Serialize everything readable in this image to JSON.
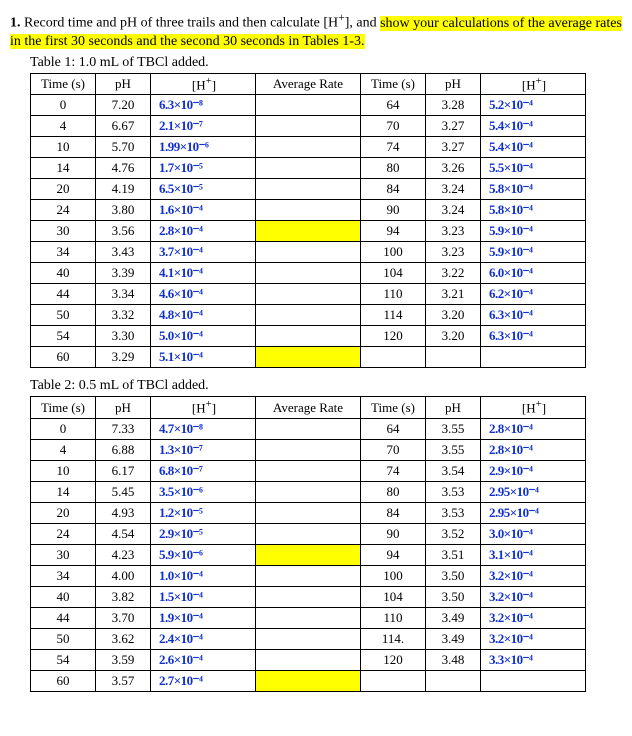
{
  "prompt": {
    "num": "1.",
    "plain1": " Record time and pH of three trails and then calculate [H",
    "sup1": "+",
    "plain2": "], and ",
    "hl": "show your calculations of the average rates in the first 30 seconds and the second 30 seconds in Tables 1-3."
  },
  "headers": {
    "time": "Time (s)",
    "ph": "pH",
    "h_pre": "[H",
    "h_sup": "+",
    "h_post": "]",
    "rate": "Average Rate"
  },
  "table1": {
    "caption": "Table 1: 1.0 mL of TBCl added.",
    "left": [
      {
        "t": "0",
        "ph": "7.20",
        "h": "6.3×10⁻⁸",
        "hl": false
      },
      {
        "t": "4",
        "ph": "6.67",
        "h": "2.1×10⁻⁷",
        "hl": false
      },
      {
        "t": "10",
        "ph": "5.70",
        "h": "1.99×10⁻⁶",
        "hl": false
      },
      {
        "t": "14",
        "ph": "4.76",
        "h": "1.7×10⁻⁵",
        "hl": false
      },
      {
        "t": "20",
        "ph": "4.19",
        "h": "6.5×10⁻⁵",
        "hl": false
      },
      {
        "t": "24",
        "ph": "3.80",
        "h": "1.6×10⁻⁴",
        "hl": false
      },
      {
        "t": "30",
        "ph": "3.56",
        "h": "2.8×10⁻⁴",
        "hl": true
      },
      {
        "t": "34",
        "ph": "3.43",
        "h": "3.7×10⁻⁴",
        "hl": false
      },
      {
        "t": "40",
        "ph": "3.39",
        "h": "4.1×10⁻⁴",
        "hl": false
      },
      {
        "t": "44",
        "ph": "3.34",
        "h": "4.6×10⁻⁴",
        "hl": false
      },
      {
        "t": "50",
        "ph": "3.32",
        "h": "4.8×10⁻⁴",
        "hl": false
      },
      {
        "t": "54",
        "ph": "3.30",
        "h": "5.0×10⁻⁴",
        "hl": false
      },
      {
        "t": "60",
        "ph": "3.29",
        "h": "5.1×10⁻⁴",
        "hl": true
      }
    ],
    "right": [
      {
        "t": "64",
        "ph": "3.28",
        "h": "5.2×10⁻⁴"
      },
      {
        "t": "70",
        "ph": "3.27",
        "h": "5.4×10⁻⁴"
      },
      {
        "t": "74",
        "ph": "3.27",
        "h": "5.4×10⁻⁴"
      },
      {
        "t": "80",
        "ph": "3.26",
        "h": "5.5×10⁻⁴"
      },
      {
        "t": "84",
        "ph": "3.24",
        "h": "5.8×10⁻⁴"
      },
      {
        "t": "90",
        "ph": "3.24",
        "h": "5.8×10⁻⁴"
      },
      {
        "t": "94",
        "ph": "3.23",
        "h": "5.9×10⁻⁴"
      },
      {
        "t": "100",
        "ph": "3.23",
        "h": "5.9×10⁻⁴"
      },
      {
        "t": "104",
        "ph": "3.22",
        "h": "6.0×10⁻⁴"
      },
      {
        "t": "110",
        "ph": "3.21",
        "h": "6.2×10⁻⁴"
      },
      {
        "t": "114",
        "ph": "3.20",
        "h": "6.3×10⁻⁴"
      },
      {
        "t": "120",
        "ph": "3.20",
        "h": "6.3×10⁻⁴"
      }
    ]
  },
  "table2": {
    "caption": "Table 2: 0.5 mL of TBCl added.",
    "left": [
      {
        "t": "0",
        "ph": "7.33",
        "h": "4.7×10⁻⁸",
        "hl": false
      },
      {
        "t": "4",
        "ph": "6.88",
        "h": "1.3×10⁻⁷",
        "hl": false
      },
      {
        "t": "10",
        "ph": "6.17",
        "h": "6.8×10⁻⁷",
        "hl": false
      },
      {
        "t": "14",
        "ph": "5.45",
        "h": "3.5×10⁻⁶",
        "hl": false
      },
      {
        "t": "20",
        "ph": "4.93",
        "h": "1.2×10⁻⁵",
        "hl": false
      },
      {
        "t": "24",
        "ph": "4.54",
        "h": "2.9×10⁻⁵",
        "hl": false
      },
      {
        "t": "30",
        "ph": "4.23",
        "h": "5.9×10⁻⁶",
        "hl": true
      },
      {
        "t": "34",
        "ph": "4.00",
        "h": "1.0×10⁻⁴",
        "hl": false
      },
      {
        "t": "40",
        "ph": "3.82",
        "h": "1.5×10⁻⁴",
        "hl": false
      },
      {
        "t": "44",
        "ph": "3.70",
        "h": "1.9×10⁻⁴",
        "hl": false
      },
      {
        "t": "50",
        "ph": "3.62",
        "h": "2.4×10⁻⁴",
        "hl": false
      },
      {
        "t": "54",
        "ph": "3.59",
        "h": "2.6×10⁻⁴",
        "hl": false
      },
      {
        "t": "60",
        "ph": "3.57",
        "h": "2.7×10⁻⁴",
        "hl": true
      }
    ],
    "right": [
      {
        "t": "64",
        "ph": "3.55",
        "h": "2.8×10⁻⁴"
      },
      {
        "t": "70",
        "ph": "3.55",
        "h": "2.8×10⁻⁴"
      },
      {
        "t": "74",
        "ph": "3.54",
        "h": "2.9×10⁻⁴"
      },
      {
        "t": "80",
        "ph": "3.53",
        "h": "2.95×10⁻⁴"
      },
      {
        "t": "84",
        "ph": "3.53",
        "h": "2.95×10⁻⁴"
      },
      {
        "t": "90",
        "ph": "3.52",
        "h": "3.0×10⁻⁴"
      },
      {
        "t": "94",
        "ph": "3.51",
        "h": "3.1×10⁻⁴"
      },
      {
        "t": "100",
        "ph": "3.50",
        "h": "3.2×10⁻⁴"
      },
      {
        "t": "104",
        "ph": "3.50",
        "h": "3.2×10⁻⁴"
      },
      {
        "t": "110",
        "ph": "3.49",
        "h": "3.2×10⁻⁴"
      },
      {
        "t": "114.",
        "ph": "3.49",
        "h": "3.2×10⁻⁴"
      },
      {
        "t": "120",
        "ph": "3.48",
        "h": "3.3×10⁻⁴"
      }
    ]
  }
}
